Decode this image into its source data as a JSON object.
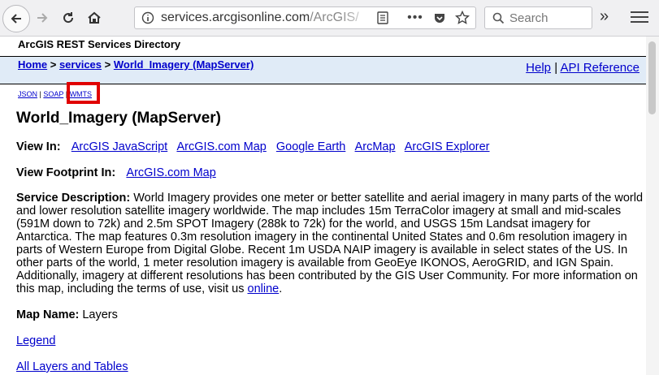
{
  "browser": {
    "url_host": "services.arcgisonline.com",
    "url_path": "/ArcGIS/",
    "search_placeholder": "Search",
    "icons": [
      "back-arrow-icon",
      "forward-arrow-icon",
      "reload-icon",
      "home-icon",
      "info-icon",
      "reader-view-icon",
      "more-actions-icon",
      "pocket-icon",
      "bookmark-star-icon",
      "search-icon",
      "overflow-chevron-icon",
      "hamburger-menu-icon"
    ]
  },
  "page": {
    "directory_title": "ArcGIS REST Services Directory",
    "breadcrumb": {
      "home": "Home",
      "sep1": " > ",
      "services": "services",
      "sep2": " > ",
      "current": "World_Imagery (MapServer)"
    },
    "help": {
      "help": "Help",
      "sep": " | ",
      "api": "API Reference"
    },
    "formats": {
      "json": "JSON",
      "sep1": " | ",
      "soap": "SOAP",
      "sep2": " | ",
      "wmts": "WMTS"
    },
    "title": "World_Imagery (MapServer)",
    "view_in": {
      "label": "View In:",
      "links": [
        "ArcGIS JavaScript",
        "ArcGIS.com Map",
        "Google Earth",
        "ArcMap",
        "ArcGIS Explorer"
      ]
    },
    "footprint": {
      "label": "View Footprint In:",
      "link": "ArcGIS.com Map"
    },
    "description": {
      "label": "Service Description:",
      "text": " World Imagery provides one meter or better satellite and aerial imagery in many parts of the world and lower resolution satellite imagery worldwide. The map includes 15m TerraColor imagery at small and mid-scales (591M down to 72k) and 2.5m SPOT Imagery (288k to 72k) for the world, and USGS 15m Landsat imagery for Antarctica. The map features 0.3m resolution imagery in the continental United States and 0.6m resolution imagery in parts of Western Europe from Digital Globe. Recent 1m USDA NAIP imagery is available in select states of the US. In other parts of the world, 1 meter resolution imagery is available from GeoEye IKONOS, AeroGRID, and IGN Spain. Additionally, imagery at different resolutions has been contributed by the GIS User Community. For more information on this map, including the terms of use, visit us ",
      "link": "online",
      "end": "."
    },
    "map_name": {
      "label": "Map Name:",
      "value": "Layers"
    },
    "legend": "Legend",
    "all_layers": "All Layers and Tables"
  },
  "colors": {
    "highlight": "#e00000",
    "link": "#0000cc",
    "breadcrumb_bg": "#e0ebf7"
  }
}
